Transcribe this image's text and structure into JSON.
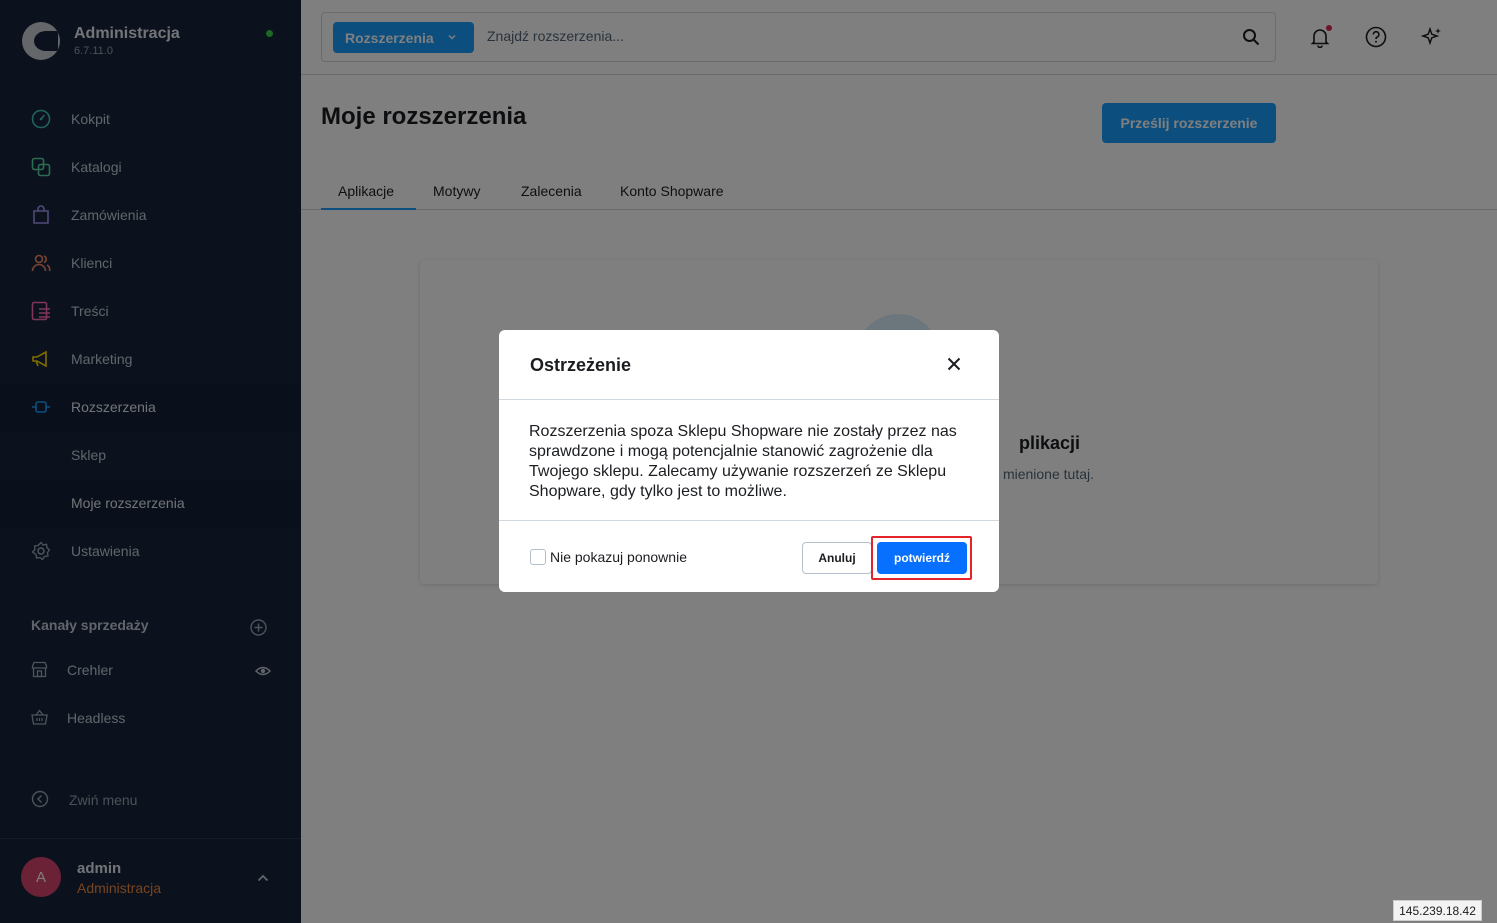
{
  "brand": {
    "title": "Administracja",
    "version": "6.7.11.0"
  },
  "nav": {
    "items": [
      {
        "label": "Kokpit",
        "icon": "dashboard-icon",
        "color": "#3ec6c2"
      },
      {
        "label": "Katalogi",
        "icon": "catalog-icon",
        "color": "#57d9a3"
      },
      {
        "label": "Zamówienia",
        "icon": "orders-icon",
        "color": "#a092f0"
      },
      {
        "label": "Klienci",
        "icon": "customers-icon",
        "color": "#f88962"
      },
      {
        "label": "Treści",
        "icon": "content-icon",
        "color": "#ff68b4"
      },
      {
        "label": "Marketing",
        "icon": "marketing-icon",
        "color": "#ffd700"
      },
      {
        "label": "Rozszerzenia",
        "icon": "extensions-icon",
        "color": "#189eff"
      },
      {
        "label": "Sklep"
      },
      {
        "label": "Moje rozszerzenia"
      },
      {
        "label": "Ustawienia",
        "icon": "settings-icon",
        "color": "#9aa8b5"
      }
    ]
  },
  "sales_channels": {
    "title": "Kanały sprzedaży",
    "items": [
      {
        "label": "Crehler",
        "icon": "storefront-icon"
      },
      {
        "label": "Headless",
        "icon": "basket-icon"
      }
    ]
  },
  "collapse_label": "Zwiń menu",
  "user": {
    "initial": "A",
    "name": "admin",
    "role": "Administracja"
  },
  "search": {
    "type_label": "Rozszerzenia",
    "placeholder": "Znajdź rozszerzenia..."
  },
  "page": {
    "title": "Moje rozszerzenia",
    "upload_button": "Prześlij rozszerzenie",
    "tabs": [
      "Aplikacje",
      "Motywy",
      "Zalecenia",
      "Konto Shopware"
    ]
  },
  "empty_state": {
    "title": "plikacji",
    "text": "mienione tutaj."
  },
  "modal": {
    "title": "Ostrzeżenie",
    "body": "Rozszerzenia spoza Sklepu Shopware nie zostały przez nas sprawdzone i mogą potencjalnie stanowić zagrożenie dla Twojego sklepu. Zalecamy używanie rozszerzeń ze Sklepu Shopware, gdy tylko jest to możliwe.",
    "checkbox_label": "Nie pokazuj ponownie",
    "cancel_label": "Anuluj",
    "confirm_label": "potwierdź"
  },
  "ip_address": "145.239.18.42",
  "colors": {
    "primary": "#189eff",
    "sidebar_bg": "#18243a",
    "confirm": "#0870ff",
    "highlight": "#e3242b"
  }
}
